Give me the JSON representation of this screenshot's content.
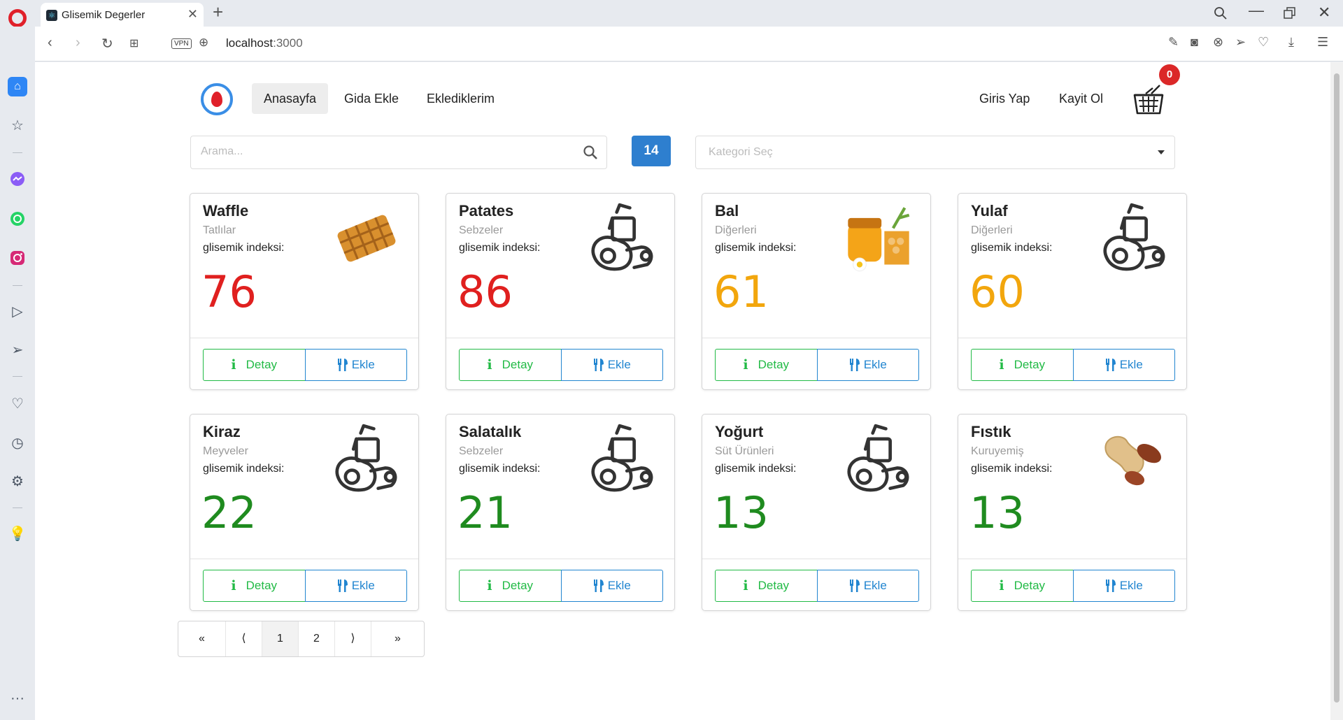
{
  "browser": {
    "tab_title": "Glisemik Degerler",
    "url_host": "localhost",
    "url_port": ":3000"
  },
  "nav": {
    "links": [
      "Anasayfa",
      "Gida Ekle",
      "Eklediklerim"
    ],
    "login": "Giris Yap",
    "register": "Kayit Ol",
    "cart_count": "0"
  },
  "search": {
    "placeholder": "Arama...",
    "result_count": "14",
    "category_placeholder": "Kategori Seç"
  },
  "card_labels": {
    "gi_label": "glisemik indeksi:",
    "detail_button": "Detay",
    "add_button": "Ekle"
  },
  "colors": {
    "high": "#e0201f",
    "medium": "#f2a60d",
    "low": "#1f8b1f",
    "detail_green": "#21ba45",
    "add_blue": "#2185d0"
  },
  "foods": [
    {
      "name": "Waffle",
      "category": "Tatlılar",
      "gi": "76",
      "level": "high",
      "image": "waffle"
    },
    {
      "name": "Patates",
      "category": "Sebzeler",
      "gi": "86",
      "level": "high",
      "image": "placeholder"
    },
    {
      "name": "Bal",
      "category": "Diğerleri",
      "gi": "61",
      "level": "medium",
      "image": "honey"
    },
    {
      "name": "Yulaf",
      "category": "Diğerleri",
      "gi": "60",
      "level": "medium",
      "image": "placeholder"
    },
    {
      "name": "Kiraz",
      "category": "Meyveler",
      "gi": "22",
      "level": "low",
      "image": "placeholder"
    },
    {
      "name": "Salatalık",
      "category": "Sebzeler",
      "gi": "21",
      "level": "low",
      "image": "placeholder"
    },
    {
      "name": "Yoğurt",
      "category": "Süt Ürünleri",
      "gi": "13",
      "level": "low",
      "image": "placeholder"
    },
    {
      "name": "Fıstık",
      "category": "Kuruyemiş",
      "gi": "13",
      "level": "low",
      "image": "peanut"
    }
  ],
  "pagination": {
    "first": "«",
    "prev": "⟨",
    "pages": [
      "1",
      "2"
    ],
    "active_page": "1",
    "next": "⟩",
    "last": "»"
  }
}
